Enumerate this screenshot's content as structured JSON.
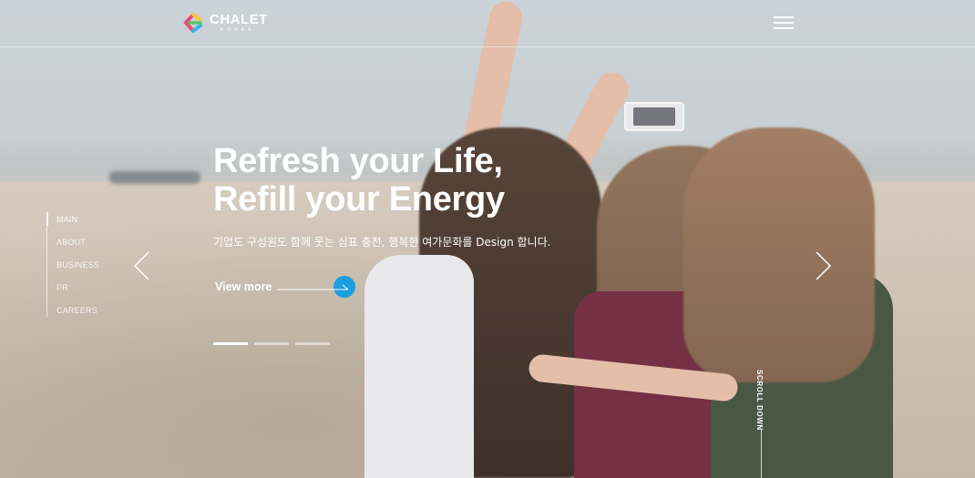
{
  "header": {
    "logo_name": "CHALET",
    "logo_sub": "KOREA",
    "menu_icon": "hamburger-icon"
  },
  "side_nav": {
    "items": [
      {
        "label": "MAIN",
        "active": true
      },
      {
        "label": "ABOUT",
        "active": false
      },
      {
        "label": "BUSINESS",
        "active": false
      },
      {
        "label": "PR",
        "active": false
      },
      {
        "label": "CAREERS",
        "active": false
      }
    ]
  },
  "hero": {
    "headline_line1": "Refresh your Life,",
    "headline_line2": "Refill your Energy",
    "subcopy": "기업도 구성원도 함께 웃는 심표 충전, 행복한 여가문화를 Design 합니다.",
    "view_more": "View more",
    "prev_icon": "chevron-left-icon",
    "next_icon": "chevron-right-icon"
  },
  "pager": {
    "count": 3,
    "active_index": 0
  },
  "scroll_down": {
    "label": "SCROLL DOWN"
  },
  "colors": {
    "accent": "#1a9ee0",
    "text": "#ffffff"
  }
}
